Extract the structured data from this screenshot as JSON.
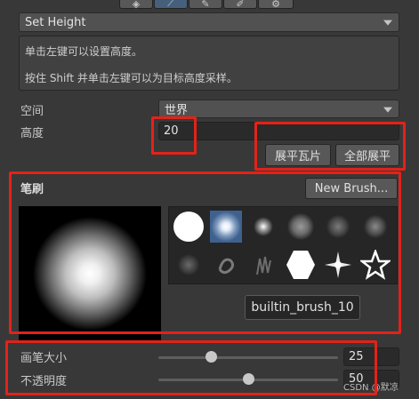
{
  "tool_icons": [
    "stamp-icon",
    "raise-lower-icon",
    "paint-icon",
    "smooth-icon",
    "settings-icon"
  ],
  "tool_dropdown": {
    "value": "Set Height"
  },
  "help": {
    "line1": "单击左键可以设置高度。",
    "line2": "按住 Shift 并单击左键可以为目标高度采样。"
  },
  "space": {
    "label": "空间",
    "value": "世界"
  },
  "height": {
    "label": "高度",
    "value": "20"
  },
  "buttons": {
    "flatten_tile": "展平瓦片",
    "flatten_all": "全部展平"
  },
  "brushes": {
    "title": "笔刷",
    "new_brush": "New Brush...",
    "selected_name": "builtin_brush_10",
    "selected_index": 1,
    "items": [
      "brush-circle-solid",
      "brush-soft-blue",
      "brush-small-soft",
      "brush-cloud",
      "brush-splatter",
      "brush-splatter-2",
      "brush-noise-1",
      "brush-noise-2",
      "brush-grass",
      "brush-hexagon",
      "brush-star-burst",
      "brush-star-outline"
    ]
  },
  "brush_size": {
    "label": "画笔大小",
    "value": "25",
    "fraction": 0.25
  },
  "opacity": {
    "label": "不透明度",
    "value": "50",
    "fraction": 0.5
  },
  "watermark": "CSDN @默凉",
  "colors": {
    "highlight": "#e32219",
    "selected": "#3e6190",
    "bg": "#383838"
  }
}
